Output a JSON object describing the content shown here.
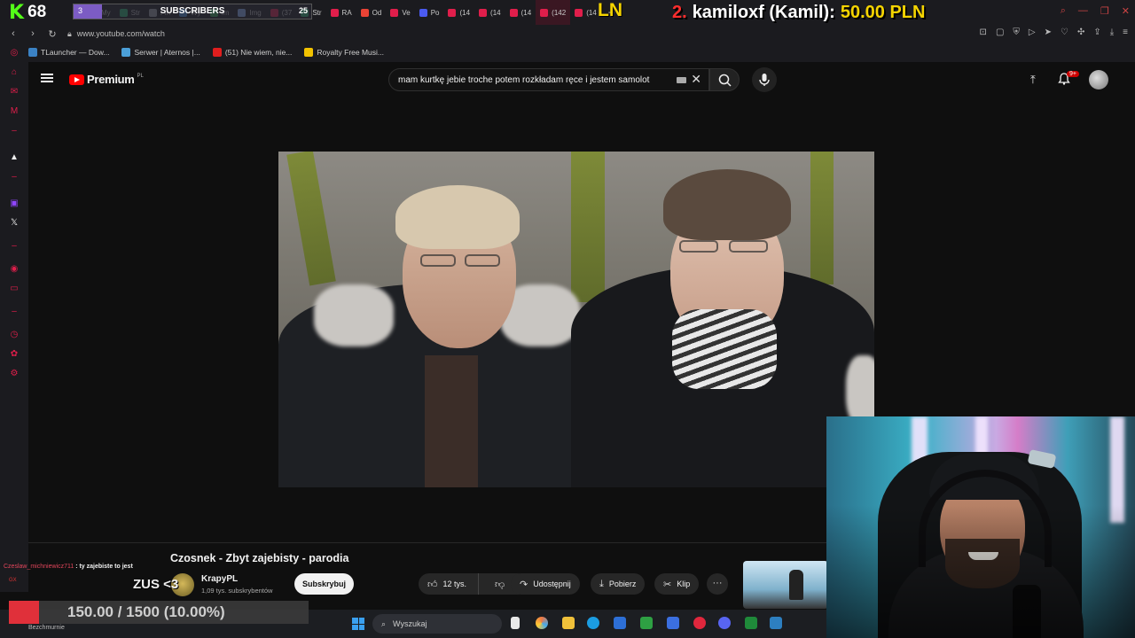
{
  "stream": {
    "kick_letter": "K",
    "kick_score": "68",
    "subs_label": "SUBSCRIBERS",
    "subs_current": "3",
    "subs_total": "25",
    "subs_progress": 0.12,
    "ln_label": "LN",
    "donation_rank": "2.",
    "donation_name": "kamiloxf (Kamil):",
    "donation_amount": "50.00 PLN",
    "chat_user": "Czeslaw_michniewicz711",
    "chat_message": ": ty zajebiste to jest",
    "chat_tag": "GX",
    "zus_text": "ZUS <3",
    "goal_text": "150.00 / 1500 (10.00%)",
    "goal_progress": 0.1,
    "goal_sub": "Bezchmurnie"
  },
  "browser": {
    "tabs": [
      {
        "label": "My",
        "color": "#e01e4b"
      },
      {
        "label": "Str",
        "color": "#2bb673"
      },
      {
        "label": "Fin",
        "color": "#9aa0a6"
      },
      {
        "label": "Wy",
        "color": "#4a90d9"
      },
      {
        "label": "Im",
        "color": "#34a853"
      },
      {
        "label": "Img",
        "color": "#8ab4f8"
      },
      {
        "label": "(37",
        "color": "#e01e4b"
      },
      {
        "label": "Str",
        "color": "#2bb673"
      },
      {
        "label": "RA",
        "color": "#e01e4b"
      },
      {
        "label": "Od",
        "color": "#ea4335"
      },
      {
        "label": "Ve",
        "color": "#e01e4b"
      },
      {
        "label": "Po",
        "color": "#4a5af0"
      },
      {
        "label": "(14",
        "color": "#e01e4b"
      },
      {
        "label": "(14",
        "color": "#e01e4b"
      },
      {
        "label": "(14",
        "color": "#e01e4b"
      },
      {
        "label": "(142",
        "color": "#e01e4b",
        "active": true
      },
      {
        "label": "(14",
        "color": "#e01e4b"
      }
    ],
    "url": "www.youtube.com/watch",
    "bookmarks": [
      {
        "label": "TLauncher — Dow...",
        "color": "#3b82c4"
      },
      {
        "label": "Serwer | Aternos |...",
        "color": "#4b9fd8"
      },
      {
        "label": "(51) Nie wiem, nie...",
        "color": "#e01e1e"
      },
      {
        "label": "Royalty Free Musi...",
        "color": "#f2c200"
      }
    ]
  },
  "youtube": {
    "brand": "Premium",
    "country": "PL",
    "search_query": "mam kurtkę jebie troche potem rozkładam ręce i jestem samolot",
    "notifications": "9+",
    "video_title": "Czosnek - Zbyt zajebisty - parodia",
    "channel_name": "KrapyPL",
    "channel_subs": "1,09 tys. subskrybentów",
    "subscribe_label": "Subskrybuj",
    "likes": "12 tys.",
    "share_label": "Udostępnij",
    "download_label": "Pobierz",
    "clip_label": "Klip",
    "more_label": "···"
  },
  "taskbar": {
    "search_placeholder": "Wyszukaj"
  },
  "icons": {
    "menu": "menu-icon",
    "search": "search-icon",
    "mic": "mic-icon",
    "upload": "upload-icon",
    "bell": "bell-icon",
    "like": "thumb-up-icon",
    "dislike": "thumb-down-icon",
    "share": "share-icon",
    "download": "download-icon",
    "clip": "scissors-icon"
  }
}
